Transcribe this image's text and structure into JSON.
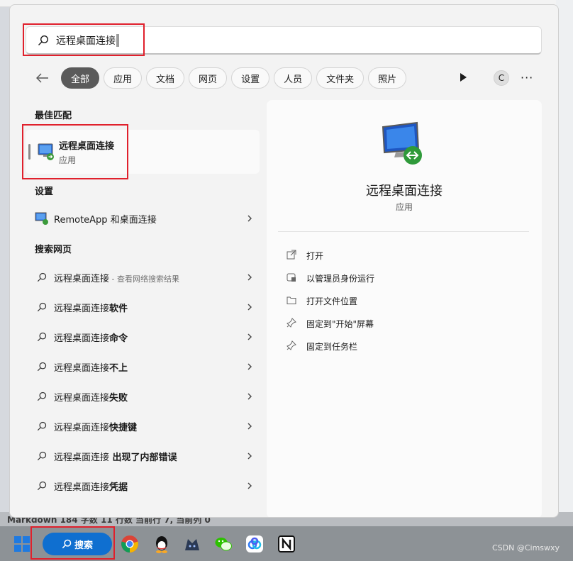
{
  "search": {
    "query": "远程桌面连接"
  },
  "filters": [
    "全部",
    "应用",
    "文档",
    "网页",
    "设置",
    "人员",
    "文件夹",
    "照片"
  ],
  "account_initial": "C",
  "more_label": "···",
  "sections": {
    "best_match": "最佳匹配",
    "settings": "设置",
    "web": "搜索网页"
  },
  "best_match": {
    "title": "远程桌面连接",
    "type": "应用"
  },
  "settings_item": "RemoteApp 和桌面连接",
  "web_results": [
    {
      "prefix": "远程桌面连接",
      "suffix": "",
      "sub": " - 查看网络搜索结果"
    },
    {
      "prefix": "远程桌面连接",
      "suffix": "软件",
      "sub": ""
    },
    {
      "prefix": "远程桌面连接",
      "suffix": "命令",
      "sub": ""
    },
    {
      "prefix": "远程桌面连接",
      "suffix": "不上",
      "sub": ""
    },
    {
      "prefix": "远程桌面连接",
      "suffix": "失败",
      "sub": ""
    },
    {
      "prefix": "远程桌面连接",
      "suffix": "快捷键",
      "sub": ""
    },
    {
      "prefix": "远程桌面连接",
      "suffix": " 出现了内部错误",
      "sub": ""
    },
    {
      "prefix": "远程桌面连接",
      "suffix": "凭据",
      "sub": ""
    }
  ],
  "detail": {
    "name": "远程桌面连接",
    "type": "应用",
    "actions": [
      "打开",
      "以管理员身份运行",
      "打开文件位置",
      "固定到\"开始\"屏幕",
      "固定到任务栏"
    ]
  },
  "status_bar": "Markdown   184 字数   11 行数   当前行 7, 当前列 0",
  "taskbar": {
    "search_label": "搜索"
  },
  "watermark": "CSDN @Cimswxy"
}
